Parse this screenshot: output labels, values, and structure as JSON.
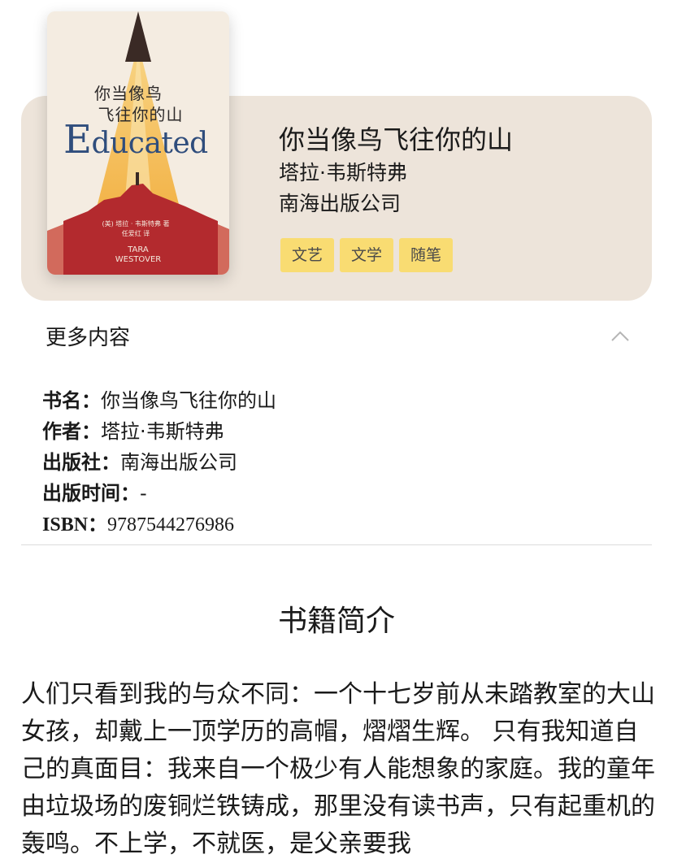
{
  "book": {
    "title": "你当像鸟飞往你的山",
    "author": "塔拉·韦斯特弗",
    "publisher": "南海出版公司",
    "tags": [
      "文艺",
      "文学",
      "随笔"
    ],
    "cover": {
      "title_cn_line1": "你当像鸟",
      "title_cn_line2": "飞往你的山",
      "title_en_first": "E",
      "title_en_rest": "ducated",
      "credit_author": "(美) 塔拉 · 韦斯特弗 著",
      "credit_translator": "任爱红 译",
      "author_en_line1": "TARA",
      "author_en_line2": "WESTOVER"
    }
  },
  "more": {
    "title": "更多内容",
    "icon": "chevron-up-icon",
    "details": [
      {
        "key": "书名：",
        "value": "你当像鸟飞往你的山"
      },
      {
        "key": "作者：",
        "value": "塔拉·韦斯特弗"
      },
      {
        "key": "出版社：",
        "value": "南海出版公司"
      },
      {
        "key": "出版时间：",
        "value": "-"
      },
      {
        "key": "ISBN：",
        "value": "9787544276986"
      }
    ]
  },
  "intro": {
    "title": "书籍简介",
    "text": "人们只看到我的与众不同：一个十七岁前从未踏教室的大山女孩，却戴上一顶学历的高帽，熠熠生辉。 只有我知道自己的真面目：我来自一个极少有人能想象的家庭。我的童年由垃圾场的废铜烂铁铸成，那里没有读书声，只有起重机的轰鸣。不上学，不就医，是父亲要我"
  },
  "colors": {
    "card_bg": "#ede4da",
    "tag_bg": "#f9dc72",
    "cover_red": "#b32a2e",
    "cover_yellow": "#f2b33d",
    "cover_title_blue": "#2f4d7c"
  }
}
